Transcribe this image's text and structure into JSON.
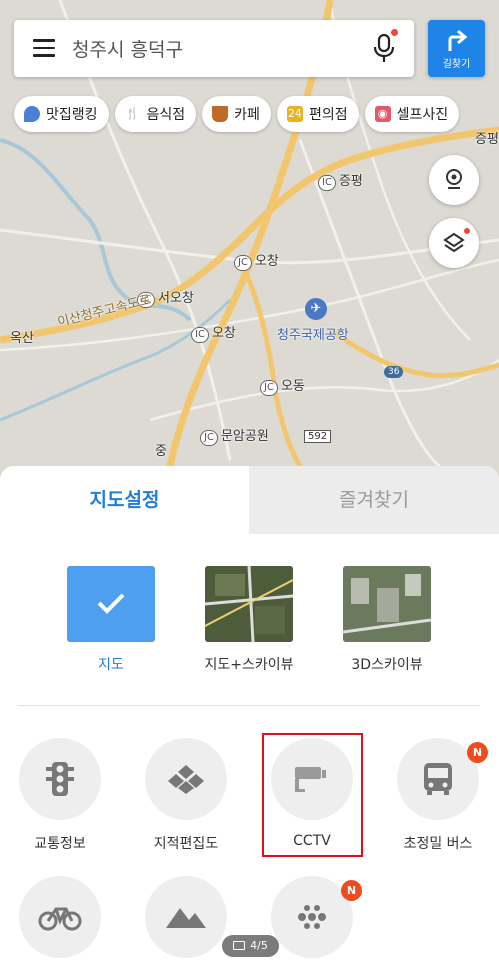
{
  "search": {
    "text": "청주시 흥덕구"
  },
  "route_button": {
    "label": "길찾기"
  },
  "chips": [
    {
      "label": "맛집랭킹",
      "icon": "pin-icon",
      "color": "#4a80d8"
    },
    {
      "label": "음식점",
      "icon": "utensils-icon",
      "color": "#e0703a"
    },
    {
      "label": "카페",
      "icon": "cup-icon",
      "color": "#c06a2a"
    },
    {
      "label": "편의점",
      "icon": "store-icon",
      "color": "#e8b224"
    },
    {
      "label": "셀프사진",
      "icon": "camera-icon",
      "color": "#e05a6a"
    }
  ],
  "map_labels": {
    "jeungpyeong": "증평",
    "jeungpyeong_edge": "증평",
    "ochang1": "오창",
    "seoochang": "서오창",
    "ochang2": "오창",
    "airport": "청주국제공항",
    "osan": "옥산",
    "odong": "오동",
    "munam": "문암공원",
    "expressway": "이산청주고속도로",
    "ic": "IC",
    "jc": "JC",
    "route36": "36",
    "route592": "592",
    "jung": "중"
  },
  "sheet": {
    "tabs": {
      "active": "지도설정",
      "inactive": "즐겨찾기"
    },
    "map_types": [
      {
        "label": "지도"
      },
      {
        "label": "지도+스카이뷰"
      },
      {
        "label": "3D스카이뷰"
      }
    ],
    "layers": [
      {
        "label": "교통정보"
      },
      {
        "label": "지적편집도"
      },
      {
        "label": "CCTV"
      },
      {
        "label": "초정밀 버스"
      }
    ],
    "new_badge": "N"
  },
  "page_indicator": "4/5",
  "colors": {
    "accent": "#1e7ed8",
    "route_button": "#1e84e8",
    "badge": "#f04a1f",
    "highlight": "#e0101a"
  }
}
